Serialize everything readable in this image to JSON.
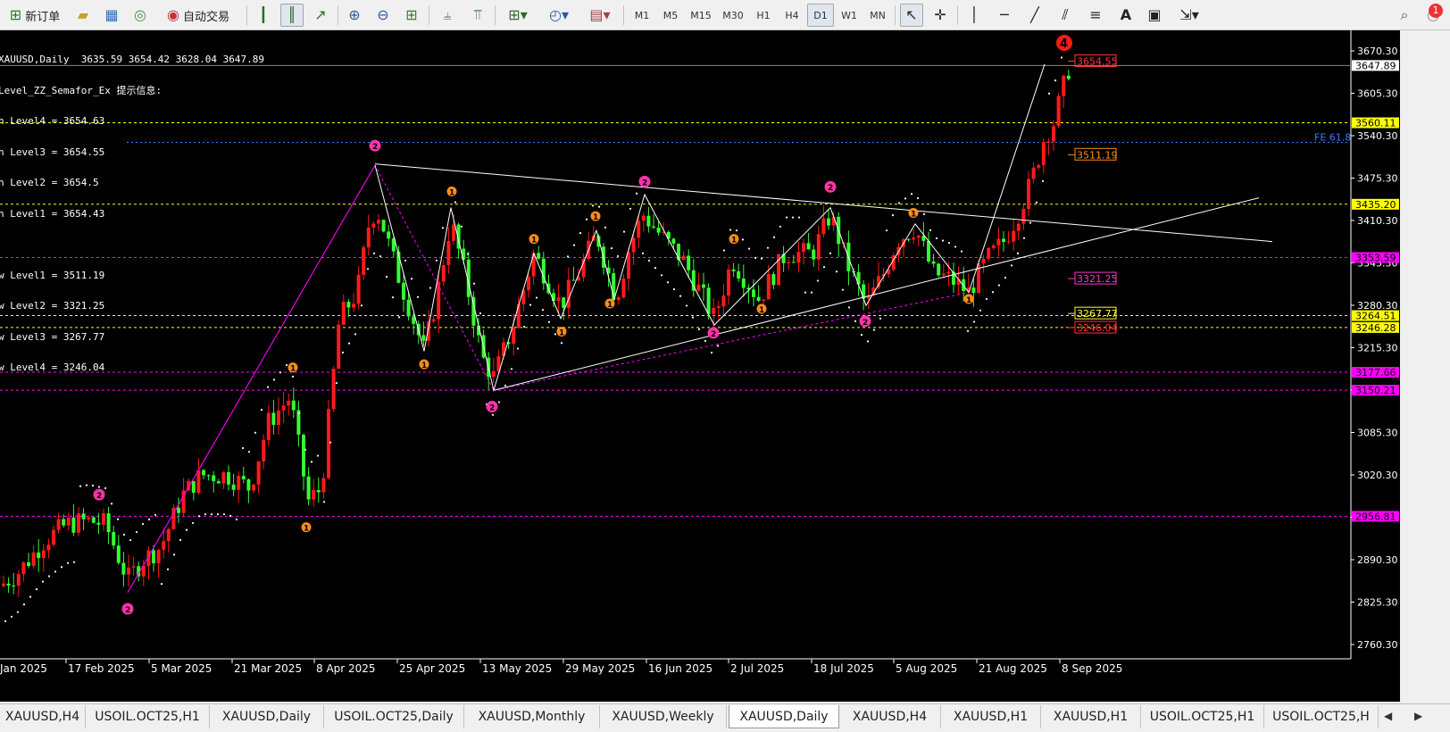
{
  "toolbar": {
    "new_order": "新订单",
    "auto_trading": "自动交易",
    "timeframes": [
      "M1",
      "M5",
      "M15",
      "M30",
      "H1",
      "H4",
      "D1",
      "W1",
      "MN"
    ],
    "active_timeframe": "D1",
    "notification_count": "1"
  },
  "chart": {
    "symbol_line": "XAUUSD,Daily  3635.59 3654.42 3628.04 3647.89",
    "indicator_title": "Level_ZZ_Semafor_Ex 提示信息:",
    "levels_high": [
      "h Level4 = 3654.63",
      "h Level3 = 3654.55",
      "h Level2 = 3654.5",
      "h Level1 = 3654.43"
    ],
    "levels_low": [
      "w Level1 = 3511.19",
      "w Level2 = 3321.25",
      "w Level3 = 3267.77",
      "w Level4 = 3246.04"
    ],
    "fe_label": "FE 61.8",
    "price_axis_ticks": [
      "3670.30",
      "3605.30",
      "3540.30",
      "3475.30",
      "3410.30",
      "3345.30",
      "3280.30",
      "3215.30",
      "3150.30",
      "3085.30",
      "3020.30",
      "2955.30",
      "2890.30",
      "2825.30",
      "2760.30"
    ],
    "price_tags": [
      {
        "text": "3647.89",
        "bg": "#ffffff",
        "fg": "#000000"
      },
      {
        "text": "3560.11",
        "bg": "#ffff00",
        "fg": "#000000"
      },
      {
        "text": "3435.20",
        "bg": "#ffff00",
        "fg": "#000000"
      },
      {
        "text": "3353.59",
        "bg": "#ff00ff",
        "fg": "#000000"
      },
      {
        "text": "3264.51",
        "bg": "#ffff00",
        "fg": "#000000"
      },
      {
        "text": "3246.28",
        "bg": "#ffff00",
        "fg": "#000000"
      },
      {
        "text": "3177.66",
        "bg": "#ff00ff",
        "fg": "#000000"
      },
      {
        "text": "3150.21",
        "bg": "#ff00ff",
        "fg": "#000000"
      },
      {
        "text": "2956.81",
        "bg": "#ff00ff",
        "fg": "#000000"
      }
    ],
    "level_labels": [
      {
        "text": "3654.55",
        "color": "#ff3333"
      },
      {
        "text": "3511.19",
        "color": "#ff8c1a"
      },
      {
        "text": "3321.25",
        "color": "#ff33cc"
      },
      {
        "text": "3267.77",
        "color": "#ffff33"
      },
      {
        "text": "3246.04",
        "color": "#ff3333"
      }
    ],
    "date_axis": [
      "Jan 2025",
      "17 Feb 2025",
      "5 Mar 2025",
      "21 Mar 2025",
      "8 Apr 2025",
      "25 Apr 2025",
      "13 May 2025",
      "29 May 2025",
      "16 Jun 2025",
      "2 Jul 2025",
      "18 Jul 2025",
      "5 Aug 2025",
      "21 Aug 2025",
      "8 Sep 2025"
    ],
    "marker_top": "4",
    "colors": {
      "up": "#ff1a1a",
      "down": "#33ff33",
      "background": "#000000",
      "trendline": "#ffffff",
      "zigzag": "#ff00ff"
    }
  },
  "tabs": [
    "XAUUSD,H4",
    "USOIL.OCT25,H1",
    "XAUUSD,Daily",
    "USOIL.OCT25,Daily",
    "XAUUSD,Monthly",
    "XAUUSD,Weekly",
    "XAUUSD,Daily",
    "XAUUSD,H4",
    "XAUUSD,H1",
    "XAUUSD,H1",
    "USOIL.OCT25,H1",
    "USOIL.OCT25,H"
  ],
  "active_tab_index": 6
}
